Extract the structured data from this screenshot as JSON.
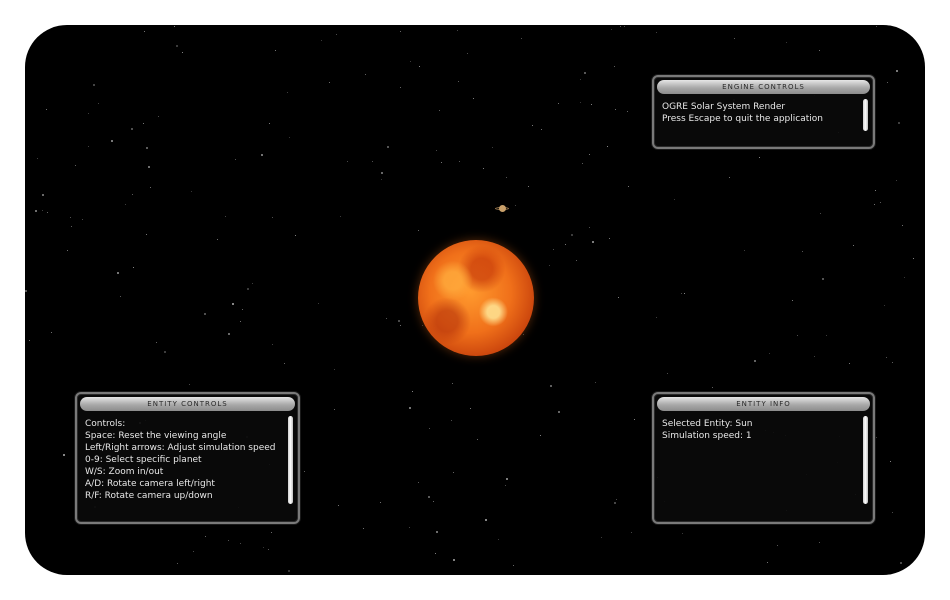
{
  "scene": {
    "background_color": "#000000",
    "sun_color": "#f0701a"
  },
  "engine_controls": {
    "title": "ENGINE CONTROLS",
    "lines": [
      "OGRE Solar System Render",
      "Press Escape to quit the application"
    ]
  },
  "entity_controls": {
    "title": "ENTITY CONTROLS",
    "lines": [
      "Controls:",
      "Space: Reset the viewing angle",
      "Left/Right arrows: Adjust simulation speed",
      "0-9: Select specific planet",
      "W/S: Zoom in/out",
      "A/D: Rotate camera left/right",
      "R/F: Rotate camera up/down"
    ]
  },
  "entity_info": {
    "title": "ENTITY INFO",
    "lines": [
      "Selected Entity: Sun",
      "Simulation speed: 1"
    ]
  }
}
